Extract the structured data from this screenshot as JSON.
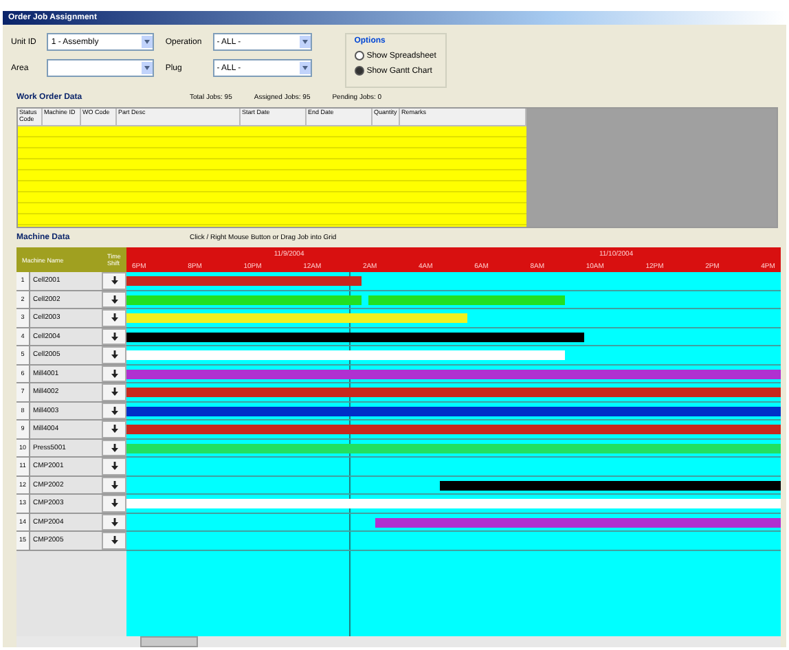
{
  "window": {
    "title": "Order Job Assignment"
  },
  "filters": [
    {
      "label": "Unit ID",
      "value": "1 - Assembly"
    },
    {
      "label": "Operation",
      "value": "- ALL -"
    },
    {
      "label": "Area"
    },
    {
      "label": "Plug",
      "value": "- ALL -"
    }
  ],
  "options": {
    "title": "Options",
    "radios": [
      {
        "label": "Show Spreadsheet",
        "selected": false
      },
      {
        "label": "Show Gantt Chart",
        "selected": true
      }
    ]
  },
  "work_orders": {
    "title": "Work Order Data",
    "counts": [
      "Total Jobs: 95",
      "Assigned Jobs: 95",
      "Pending Jobs: 0"
    ],
    "columns": [
      "Status Code",
      "Machine ID",
      "WO Code",
      "Part Desc",
      "Start Date",
      "End Date",
      "Quantity",
      "Remarks"
    ]
  },
  "gantt": {
    "title": "Machine Data",
    "hint": "Click / Right Mouse Button or Drag Job into Grid",
    "columns": [
      "Machine Name",
      "Time Shift"
    ],
    "dates": [
      "11/9/2004",
      "11/10/2004"
    ],
    "ticks": [
      "6PM",
      "8PM",
      "10PM",
      "12AM",
      "2AM",
      "4AM",
      "6AM",
      "8AM",
      "10AM",
      "12PM",
      "2PM",
      "4PM"
    ],
    "rows": [
      {
        "number": "1",
        "name": "Cell2001",
        "segments": [
          {
            "color": "#c8281e"
          }
        ]
      },
      {
        "number": "2",
        "name": "Cell2002",
        "segments": [
          {
            "color": "#22e022"
          },
          {
            "color": "#22e022"
          }
        ]
      },
      {
        "number": "3",
        "name": "Cell2003",
        "segments": [
          {
            "color": "#f0f020"
          }
        ]
      },
      {
        "number": "4",
        "name": "Cell2004",
        "segments": [
          {
            "color": "#000000"
          }
        ]
      },
      {
        "number": "5",
        "name": "Cell2005",
        "segments": [
          {
            "color": "#ffffff"
          }
        ]
      },
      {
        "number": "6",
        "name": "Mill4001",
        "segments": [
          {
            "color": "#b030d0"
          }
        ]
      },
      {
        "number": "7",
        "name": "Mill4002",
        "segments": [
          {
            "color": "#c8281e"
          }
        ]
      },
      {
        "number": "8",
        "name": "Mill4003",
        "segments": [
          {
            "color": "#0030c8"
          }
        ]
      },
      {
        "number": "9",
        "name": "Mill4004",
        "segments": [
          {
            "color": "#c8281e"
          }
        ]
      },
      {
        "number": "10",
        "name": "Press5001",
        "segments": [
          {
            "color": "#22e060"
          }
        ]
      },
      {
        "number": "11",
        "name": "CMP2001",
        "segments": []
      },
      {
        "number": "12",
        "name": "CMP2002",
        "segments": [
          {
            "color": "#000000"
          }
        ]
      },
      {
        "number": "13",
        "name": "CMP2003",
        "segments": [
          {
            "color": "#ffffff"
          }
        ]
      },
      {
        "number": "14",
        "name": "CMP2004",
        "segments": [
          {
            "color": "#b030d0"
          }
        ]
      },
      {
        "number": "15",
        "name": "CMP2005",
        "segments": []
      }
    ]
  }
}
